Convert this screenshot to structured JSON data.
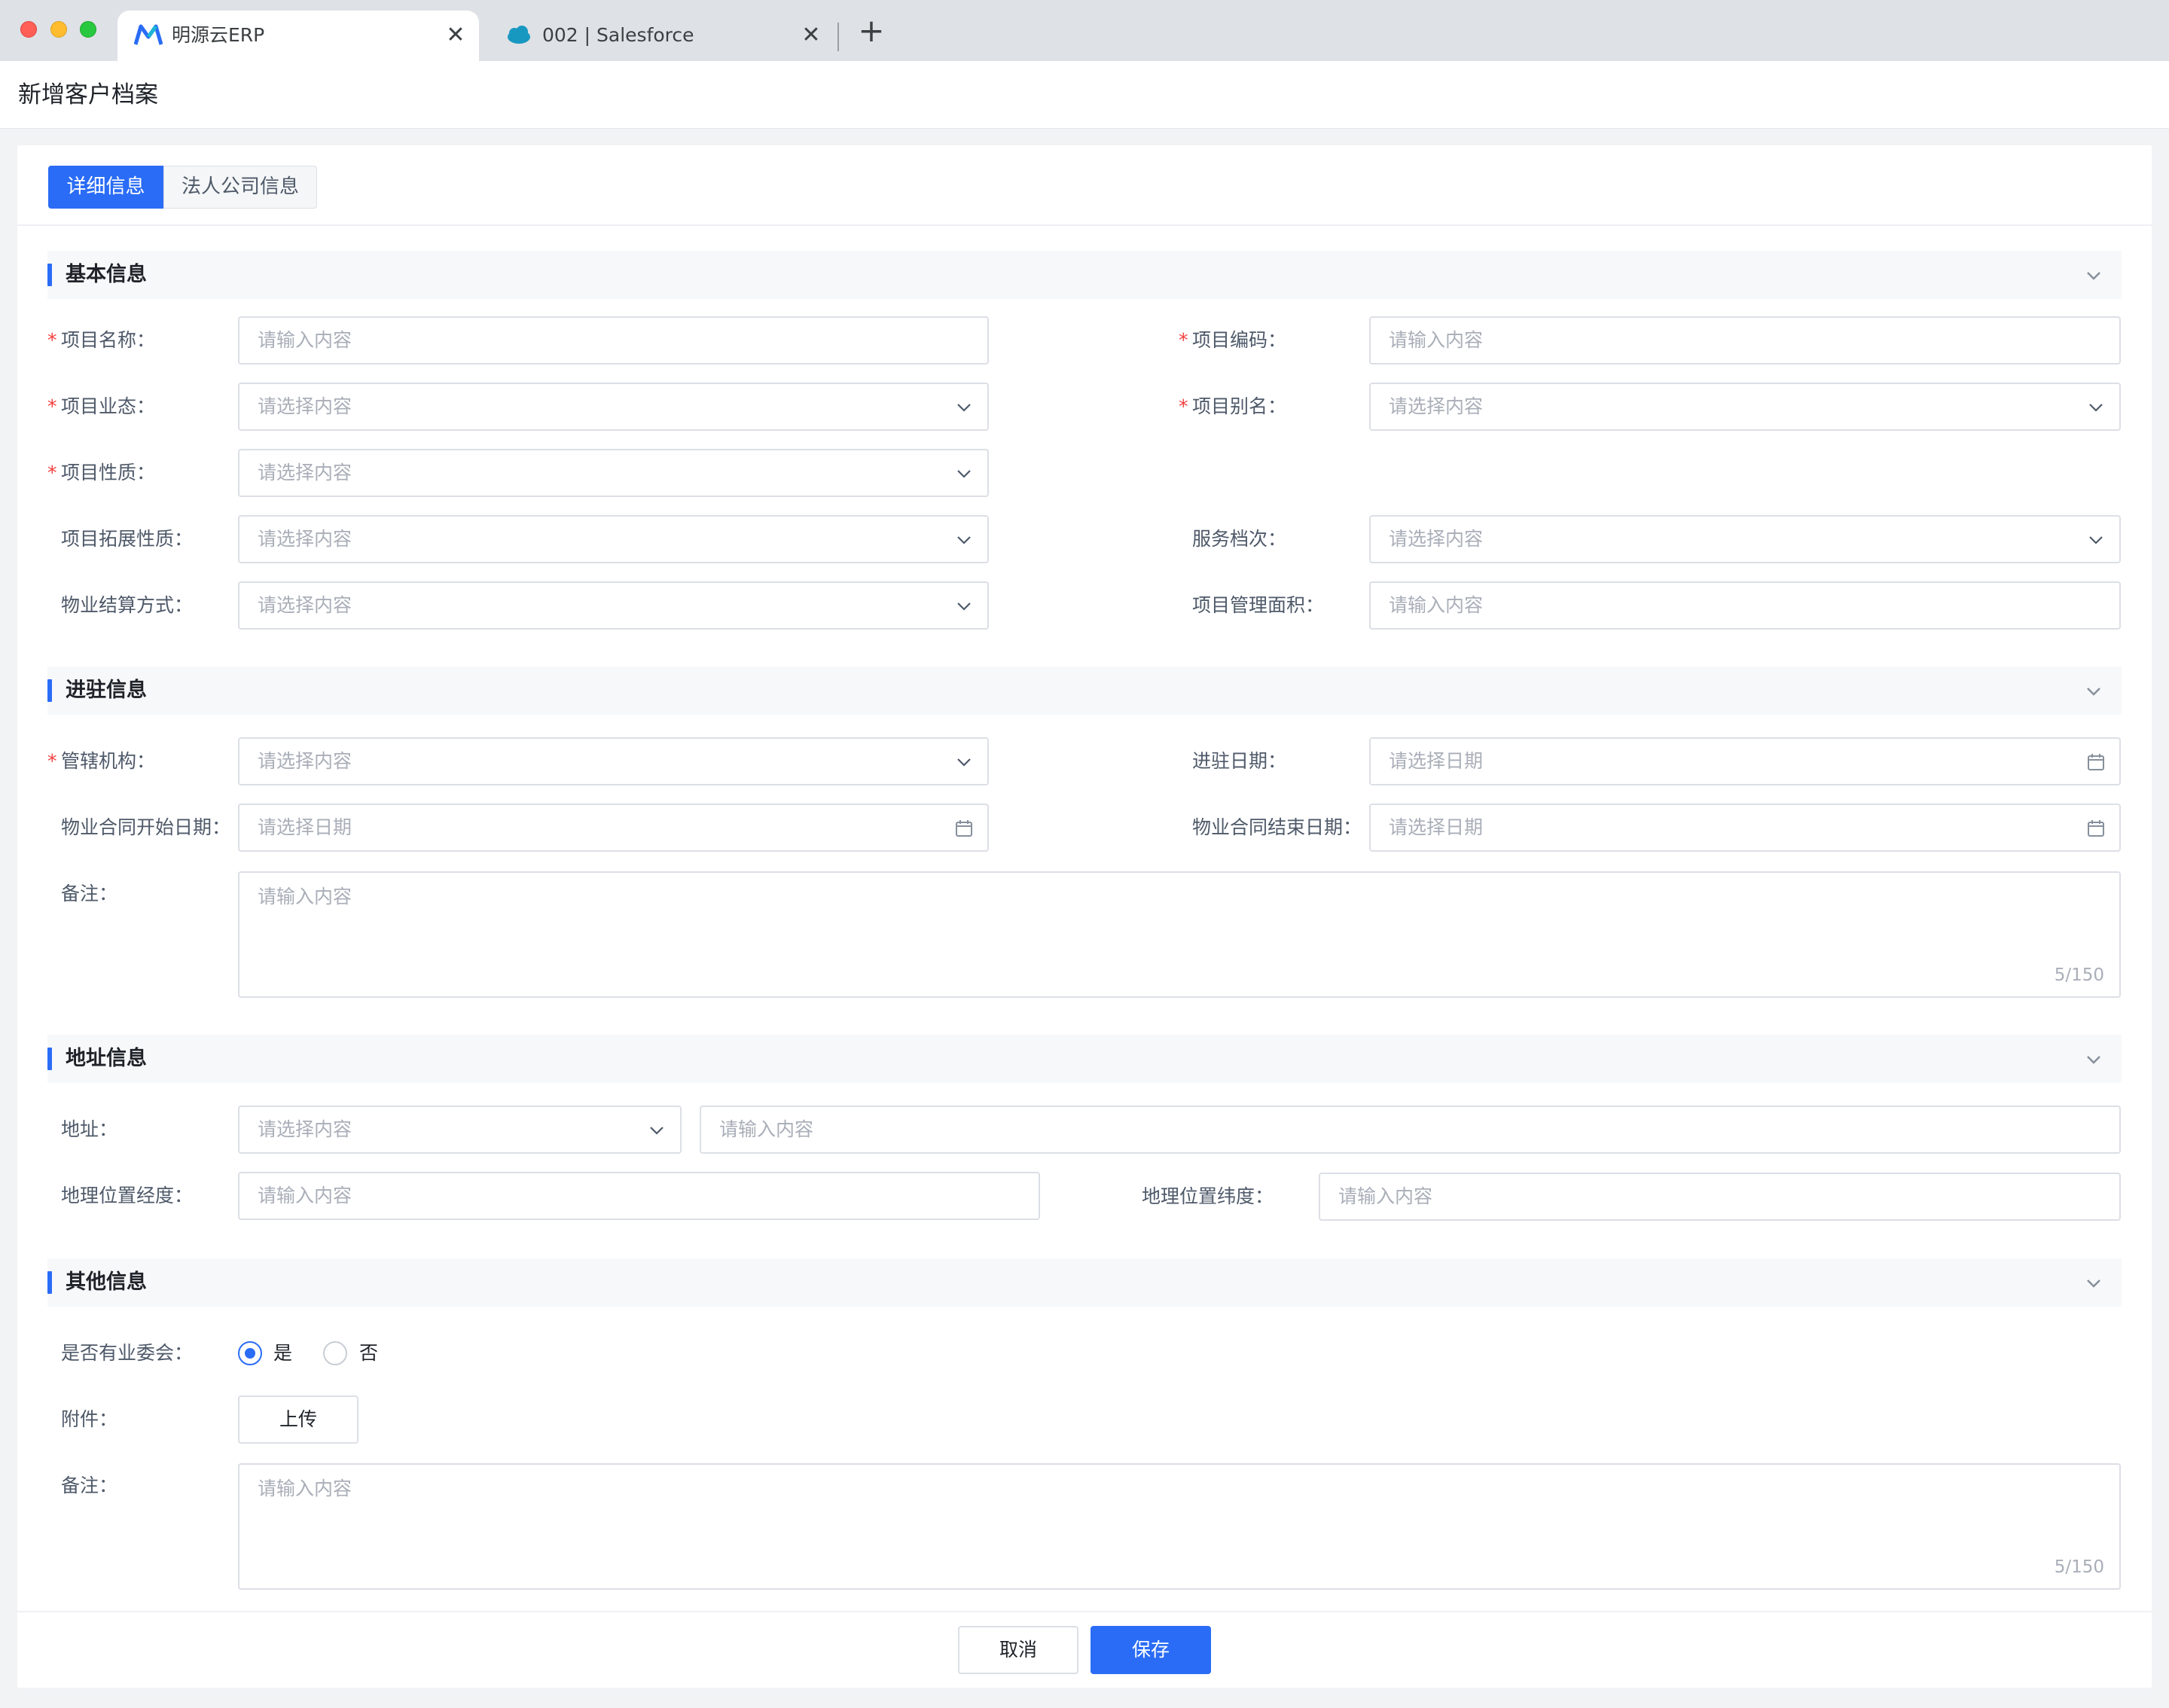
{
  "browser": {
    "tabs": [
      {
        "title": "明源云ERP",
        "active": true,
        "favicon": "mingyuan-logo-icon"
      },
      {
        "title": "002 | Salesforce",
        "active": false,
        "favicon": "salesforce-cloud-icon"
      }
    ],
    "new_tab": "+"
  },
  "page": {
    "title": "新增客户档案"
  },
  "form_tabs": [
    {
      "label": "详细信息",
      "active": true
    },
    {
      "label": "法人公司信息",
      "active": false
    }
  ],
  "sections": {
    "basic": {
      "title": "基本信息",
      "project_name": {
        "label": "项目名称：",
        "placeholder": "请输入内容",
        "required": true
      },
      "project_code": {
        "label": "项目编码：",
        "placeholder": "请输入内容",
        "required": true
      },
      "project_format": {
        "label": "项目业态：",
        "placeholder": "请选择内容",
        "required": true
      },
      "project_alias": {
        "label": "项目别名：",
        "placeholder": "请选择内容",
        "required": true
      },
      "project_nature": {
        "label": "项目性质：",
        "placeholder": "请选择内容",
        "required": true
      },
      "project_ext_nature": {
        "label": "项目拓展性质：",
        "placeholder": "请选择内容",
        "required": false
      },
      "service_level": {
        "label": "服务档次：",
        "placeholder": "请选择内容",
        "required": false
      },
      "settlement_method": {
        "label": "物业结算方式：",
        "placeholder": "请选择内容",
        "required": false
      },
      "managed_area": {
        "label": "项目管理面积：",
        "placeholder": "请输入内容",
        "required": false
      }
    },
    "entry": {
      "title": "进驻信息",
      "jurisdiction": {
        "label": "管辖机构：",
        "placeholder": "请选择内容",
        "required": true
      },
      "entry_date": {
        "label": "进驻日期：",
        "placeholder": "请选择日期",
        "required": false
      },
      "contract_start": {
        "label": "物业合同开始日期：",
        "placeholder": "请选择日期"
      },
      "contract_end": {
        "label": "物业合同结束日期：",
        "placeholder": "请选择日期"
      },
      "remark": {
        "label": "备注：",
        "placeholder": "请输入内容",
        "count": "5/150"
      }
    },
    "address": {
      "title": "地址信息",
      "address": {
        "label": "地址：",
        "select_placeholder": "请选择内容",
        "input_placeholder": "请输入内容"
      },
      "longitude": {
        "label": "地理位置经度：",
        "placeholder": "请输入内容"
      },
      "latitude": {
        "label": "地理位置纬度：",
        "placeholder": "请输入内容"
      }
    },
    "other": {
      "title": "其他信息",
      "committee": {
        "label": "是否有业委会：",
        "options": [
          "是",
          "否"
        ],
        "selected": "是"
      },
      "attachment": {
        "label": "附件：",
        "button": "上传"
      },
      "remark": {
        "label": "备注：",
        "placeholder": "请输入内容",
        "count": "5/150"
      }
    }
  },
  "footer": {
    "cancel": "取消",
    "save": "保存"
  },
  "colors": {
    "primary": "#2a6cf6",
    "required": "#f53f3f"
  }
}
